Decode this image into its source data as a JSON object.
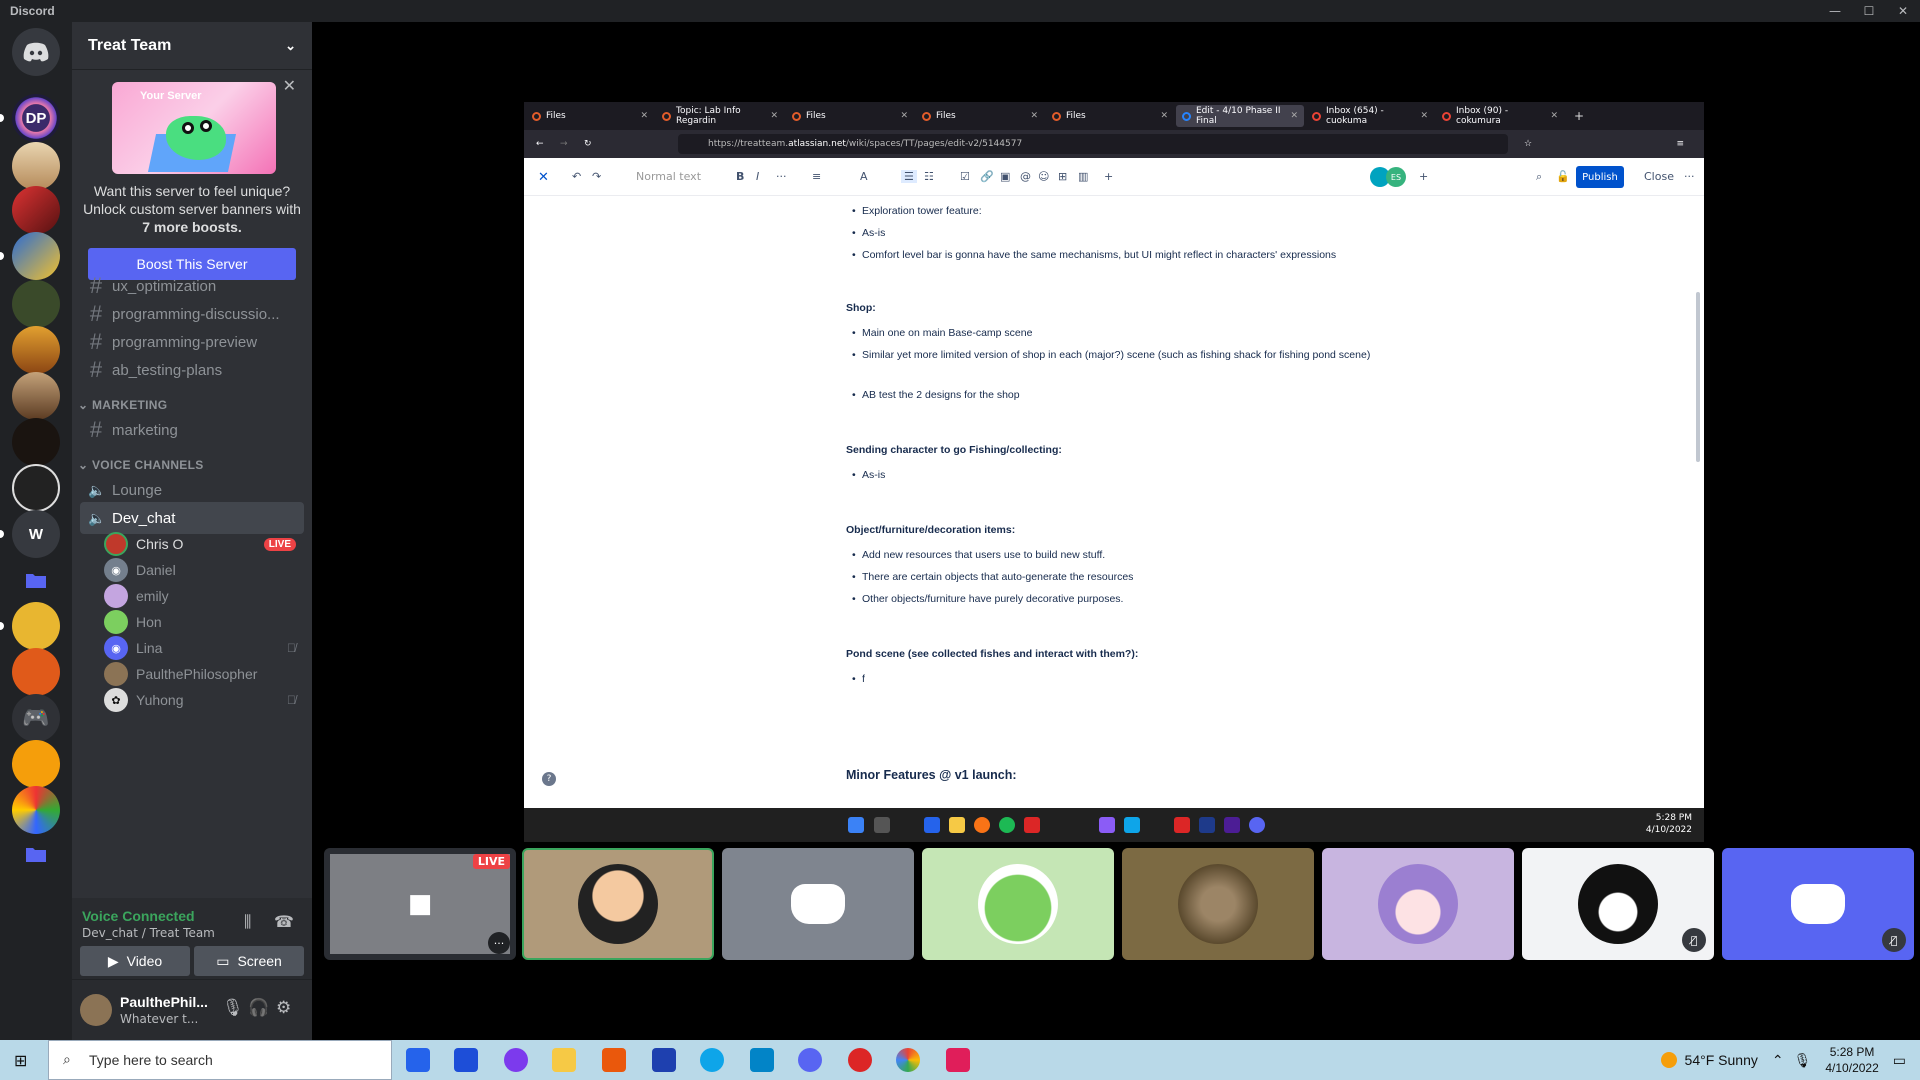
{
  "window": {
    "app_name": "Discord"
  },
  "server": {
    "name": "Treat Team",
    "boost": {
      "banner_label": "Your Server",
      "line1": "Want this server to feel unique?",
      "line2": "Unlock custom server banners with",
      "line3": "7 more boosts.",
      "button": "Boost This Server"
    },
    "channels": [
      "ux_optimization",
      "programming-discussio...",
      "programming-preview",
      "ab_testing-plans"
    ],
    "marketing_category": "MARKETING",
    "marketing_channel": "marketing",
    "voice_category": "VOICE CHANNELS",
    "voice_channels": [
      "Lounge",
      "Dev_chat"
    ],
    "voice_users": [
      {
        "name": "Chris O",
        "badge": "LIVE"
      },
      {
        "name": "Daniel"
      },
      {
        "name": "emily"
      },
      {
        "name": "Hon"
      },
      {
        "name": "Lina"
      },
      {
        "name": "PaulthePhilosopher"
      },
      {
        "name": "Yuhong"
      }
    ]
  },
  "rail": {
    "home_letter": "W",
    "dp_label": "DP"
  },
  "rtc": {
    "status": "Voice Connected",
    "location": "Dev_chat / Treat Team",
    "video": "Video",
    "screen": "Screen"
  },
  "user": {
    "name": "PaulthePhil...",
    "status": "Whatever t..."
  },
  "browser": {
    "tabs": [
      "Files",
      "Topic: Lab Info Regardin",
      "Files",
      "Files",
      "Files",
      "Edit - 4/10 Phase II Final",
      "Inbox (654) - cuokuma",
      "Inbox (90) - cokumura"
    ],
    "url_prefix": "https://treatteam.",
    "url_domain": "atlassian.net",
    "url_path": "/wiki/spaces/TT/pages/edit-v2/5144577"
  },
  "editor": {
    "text_style": "Normal text",
    "publish": "Publish",
    "close": "Close",
    "avatar_initials": [
      "ES"
    ]
  },
  "doc": {
    "s0": [
      "Exploration tower feature:",
      "As-is",
      "Comfort level bar is gonna have the same mechanisms, but UI might reflect in characters' expressions"
    ],
    "shop_h": "Shop:",
    "shop": [
      "Main one on main Base-camp scene",
      "Similar yet more limited version of shop in each (major?) scene (such as fishing shack for fishing pond scene)",
      "AB test the 2 designs for the shop"
    ],
    "fish_h": "Sending character to go Fishing/collecting:",
    "fish": [
      "As-is"
    ],
    "obj_h": "Object/furniture/decoration items:",
    "obj": [
      "Add new resources that users use to build new stuff.",
      "There are certain objects that auto-generate the resources",
      "Other objects/furniture have purely decorative purposes."
    ],
    "pond_h": "Pond scene (see collected fishes and interact with them?):",
    "pond": [
      "f"
    ],
    "minor_h": "Minor Features @ v1 launch:"
  },
  "inner_clock": {
    "time": "5:28 PM",
    "date": "4/10/2022"
  },
  "stream_badge": "LIVE",
  "taskbar": {
    "search_placeholder": "Type here to search",
    "weather": "54°F  Sunny",
    "time": "5:28 PM",
    "date": "4/10/2022"
  },
  "colors": {
    "blurple": "#5865f2",
    "green": "#3ba55d",
    "red": "#ed4245",
    "atlassian_blue": "#0052cc"
  }
}
